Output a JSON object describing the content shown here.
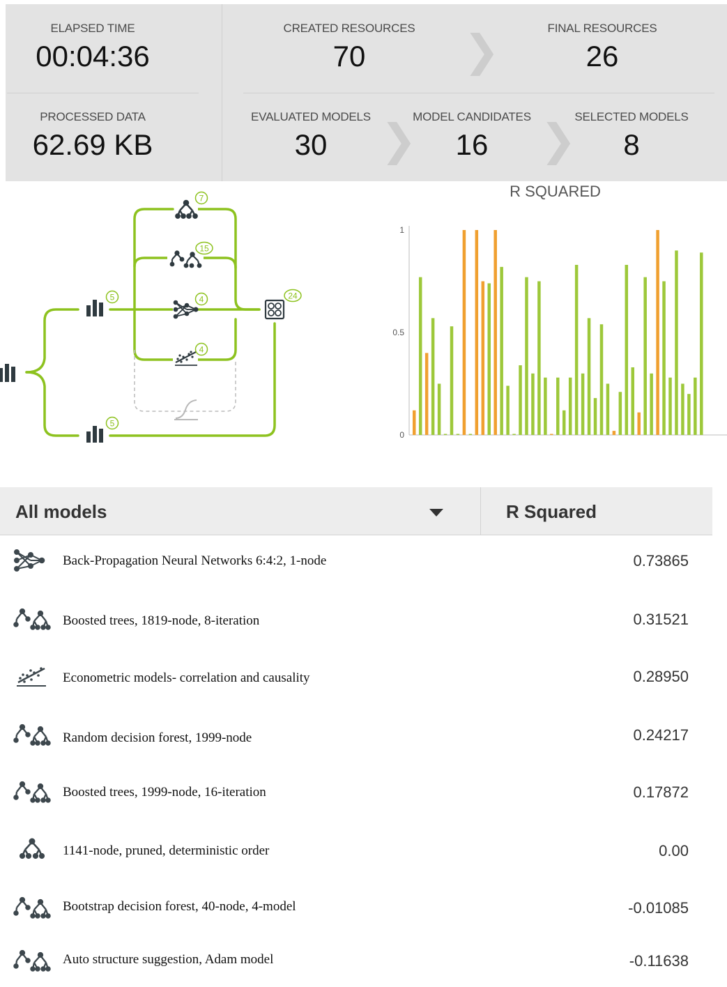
{
  "stats": {
    "elapsed": {
      "label": "ELAPSED TIME",
      "value": "00:04:36"
    },
    "created": {
      "label": "CREATED RESOURCES",
      "value": "70"
    },
    "final": {
      "label": "FINAL RESOURCES",
      "value": "26"
    },
    "processed": {
      "label": "PROCESSED DATA",
      "value": "62.69 KB"
    },
    "evaluated": {
      "label": "EVALUATED MODELS",
      "value": "30"
    },
    "candidates": {
      "label": "MODEL CANDIDATES",
      "value": "16"
    },
    "selected": {
      "label": "SELECTED MODELS",
      "value": "8"
    }
  },
  "workflow": {
    "badges": {
      "dataset_top": "5",
      "dataset_bottom": "5",
      "trees": "7",
      "ensembles": "15",
      "deepnets": "4",
      "linear": "4",
      "evaluations": "24"
    },
    "accent_color": "#8dc21f",
    "icons": [
      "dataset-icon",
      "decision-tree-icon",
      "ensemble-icon",
      "deepnet-icon",
      "linear-regression-icon",
      "logistic-curve-icon",
      "evaluation-icon"
    ]
  },
  "chart_data": {
    "type": "bar",
    "title": "R SQUARED",
    "ylim": [
      0,
      1
    ],
    "yticks": [
      "0",
      "0.5",
      "1"
    ],
    "colors": {
      "green": "#9dc83a",
      "orange": "#f0a030"
    },
    "values": [
      0.12,
      0.77,
      0.4,
      0.57,
      0.25,
      0.0,
      0.53,
      0.0,
      1.0,
      0.0,
      1.0,
      0.75,
      0.74,
      1.0,
      0.82,
      0.24,
      0.0,
      0.34,
      0.77,
      0.3,
      0.75,
      0.28,
      0.0,
      0.28,
      0.12,
      0.28,
      0.83,
      0.3,
      0.57,
      0.18,
      0.54,
      0.25,
      0.02,
      0.21,
      0.83,
      0.33,
      0.11,
      0.77,
      0.3,
      1.0,
      0.75,
      0.28,
      0.9,
      0.25,
      0.2,
      0.28,
      0.89
    ],
    "highlight": [
      "orange",
      "green",
      "orange",
      "green",
      "green",
      "green",
      "green",
      "green",
      "orange",
      "green",
      "orange",
      "orange",
      "green",
      "orange",
      "green",
      "green",
      "green",
      "green",
      "green",
      "green",
      "green",
      "green",
      "orange",
      "green",
      "green",
      "green",
      "green",
      "green",
      "green",
      "green",
      "green",
      "green",
      "orange",
      "green",
      "green",
      "green",
      "orange",
      "green",
      "green",
      "orange",
      "green",
      "green",
      "green",
      "green",
      "green",
      "green",
      "green"
    ]
  },
  "table": {
    "header_models": "All models",
    "header_metric": "R Squared",
    "rows": [
      {
        "name": "Back-Propagation Neural Networks 6:4:2, 1-node",
        "score": "0.73865",
        "icon": "deepnet-icon"
      },
      {
        "name": "Boosted trees, 1819-node, 8-iteration",
        "score": "0.31521",
        "icon": "ensemble-icon"
      },
      {
        "name": "Econometric models- correlation and causality",
        "score": "0.28950",
        "icon": "linear-regression-icon"
      },
      {
        "name": "Random decision forest, 1999-node",
        "score": "0.24217",
        "icon": "ensemble-icon"
      },
      {
        "name": "Boosted trees, 1999-node, 16-iteration",
        "score": "0.17872",
        "icon": "ensemble-icon"
      },
      {
        "name": "1141-node, pruned, deterministic order",
        "score": "0.00",
        "icon": "decision-tree-icon"
      },
      {
        "name": "Bootstrap decision forest, 40-node, 4-model",
        "score": "-0.01085",
        "icon": "ensemble-icon"
      },
      {
        "name": "Auto structure suggestion, Adam model",
        "score": "-0.11638",
        "icon": "ensemble-icon"
      }
    ]
  }
}
